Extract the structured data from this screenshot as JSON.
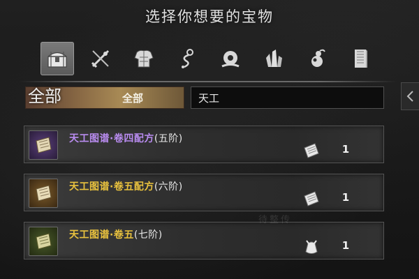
{
  "title": "选择你想要的宝物",
  "tabs": [
    {
      "icon": "treasure-chest-icon",
      "active": true
    },
    {
      "icon": "crossed-weapons-icon",
      "active": false
    },
    {
      "icon": "armor-icon",
      "active": false
    },
    {
      "icon": "ornament-icon",
      "active": false
    },
    {
      "icon": "cauldron-icon",
      "active": false
    },
    {
      "icon": "crystal-icon",
      "active": false
    },
    {
      "icon": "gourd-icon",
      "active": false
    },
    {
      "icon": "scroll-stack-icon",
      "active": false
    }
  ],
  "filter": {
    "category_big": "全部",
    "category_selected": "全部",
    "search_value": "天工"
  },
  "items": [
    {
      "name": "天工图谱·卷四配方",
      "grade": "(五阶)",
      "quality": "purple",
      "type_icon": "recipe-paper-icon",
      "quantity": "1"
    },
    {
      "name": "天工图谱·卷五配方",
      "grade": "(六阶)",
      "quality": "gold",
      "type_icon": "recipe-paper-icon",
      "quantity": "1"
    },
    {
      "name": "天工图谱·卷五",
      "grade": "(七阶)",
      "quality": "gold",
      "type_icon": "pouch-icon",
      "quantity": "1"
    }
  ],
  "background_faint_text": "待整传",
  "colors": {
    "purple_quality": "#b98cf0",
    "gold_quality": "#e9c23e",
    "active_tab": "#6a6a6a"
  }
}
